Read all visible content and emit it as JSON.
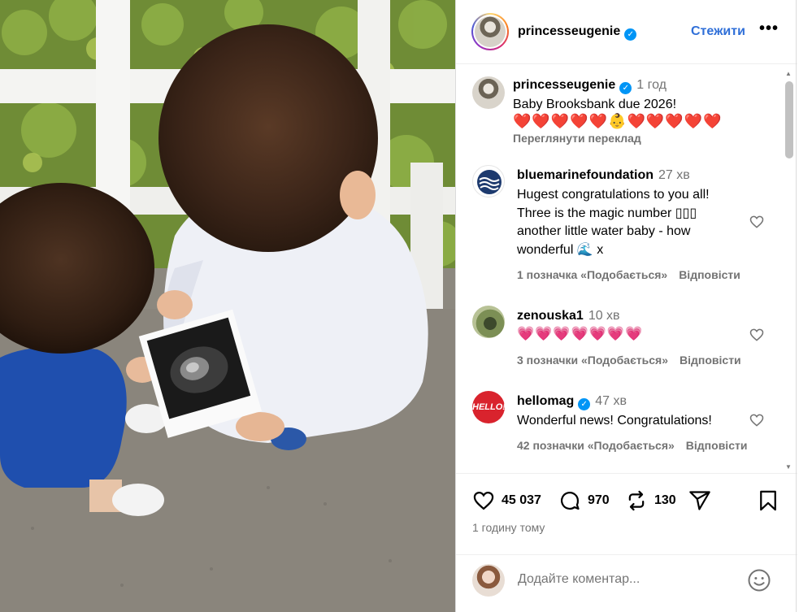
{
  "post": {
    "author": "princesseugenie",
    "follow_label": "Стежити",
    "more_label": "•••",
    "verified_mark": "✓"
  },
  "caption": {
    "author": "princesseugenie",
    "time": "1 год",
    "text": "Baby Brooksbank due 2026!",
    "emoji": "❤️❤️❤️❤️❤️👶❤️❤️❤️❤️❤️",
    "translate_label": "Переглянути переклад"
  },
  "comments": [
    {
      "author": "bluemarinefoundation",
      "time": "27 хв",
      "lines": [
        "Hugest congratulations to you all!",
        "Three is the magic number ▯▯▯",
        "another little water baby - how",
        "wonderful 🌊 x"
      ],
      "likes": "1 позначка «Подобається»",
      "reply": "Відповісти"
    },
    {
      "author": "zenouska1",
      "time": "10 хв",
      "lines": [
        "💗💗💗💗💗💗💗"
      ],
      "likes": "3 позначки «Подобається»",
      "reply": "Відповісти"
    },
    {
      "author": "hellomag",
      "time": "47 хв",
      "lines": [
        "Wonderful news! Congratulations!"
      ],
      "likes": "42 позначки «Подобається»",
      "reply": "Відповісти",
      "avatar_text": "HELLO!"
    }
  ],
  "stats": {
    "likes": "45 037",
    "comments": "970",
    "reposts": "130"
  },
  "posted_ago": "1 годину тому",
  "composer": {
    "placeholder": "Додайте коментар..."
  },
  "colors": {
    "accent": "#2f6fd8",
    "verified": "#0095f6",
    "muted": "#737373",
    "hello_red": "#d9232d"
  },
  "icons": [
    "heart-icon",
    "comment-icon",
    "repost-icon",
    "share-icon",
    "bookmark-icon",
    "emoji-icon",
    "more-icon"
  ]
}
